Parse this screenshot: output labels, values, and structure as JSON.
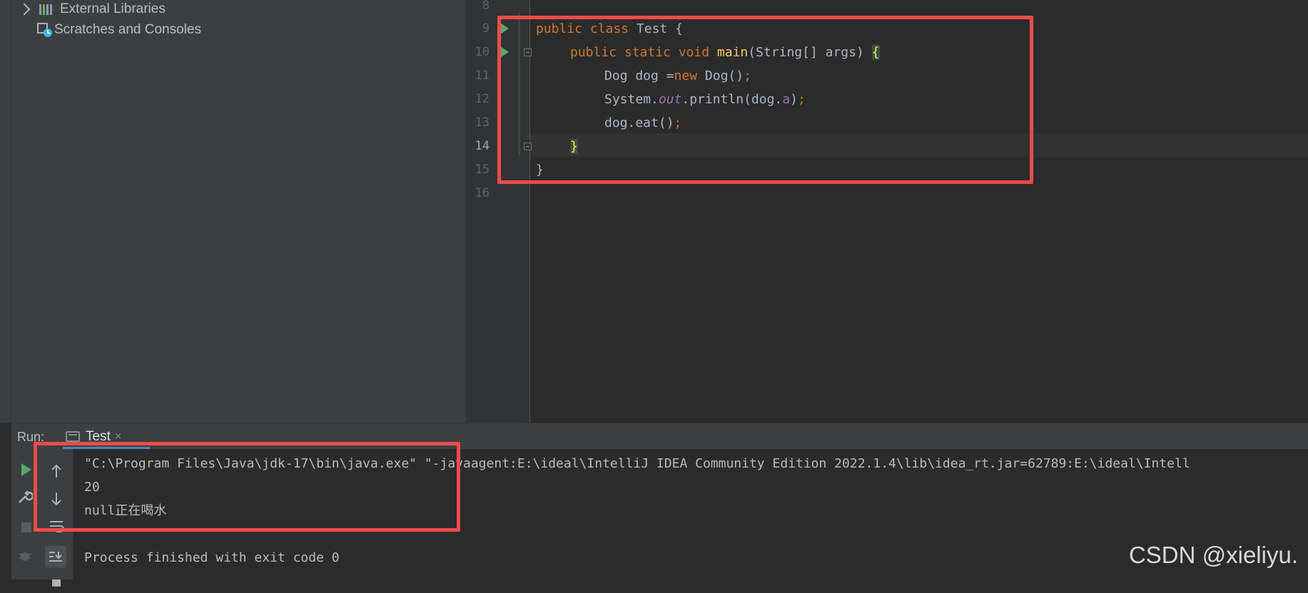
{
  "project_tree": {
    "items": [
      {
        "label": "External Libraries",
        "expandable": true,
        "icon": "library-icon"
      },
      {
        "label": "Scratches and Consoles",
        "expandable": false,
        "icon": "scratches-icon"
      }
    ]
  },
  "editor": {
    "line_numbers": [
      "8",
      "9",
      "10",
      "11",
      "12",
      "13",
      "14",
      "15",
      "16"
    ],
    "current_line": "14",
    "code": {
      "l9_kw": "public class ",
      "l9_rest": "Test {",
      "l10_kw": "public static void ",
      "l10_fn": "main",
      "l10_rest": "(String[] args) ",
      "l10_brace": "{",
      "l11_a": "Dog dog =",
      "l11_kw": "new ",
      "l11_b": "Dog()",
      "l11_semi": ";",
      "l12_a": "System.",
      "l12_static": "out",
      "l12_b": ".println(dog.",
      "l12_field": "a",
      "l12_c": ")",
      "l12_semi": ";",
      "l13_a": "dog.eat()",
      "l13_semi": ";",
      "l14_brace": "}",
      "l15": "}"
    }
  },
  "run_panel": {
    "label": "Run:",
    "tab_name": "Test",
    "tab_close": "×",
    "console_lines": [
      "\"C:\\Program Files\\Java\\jdk-17\\bin\\java.exe\" \"-javaagent:E:\\ideal\\IntelliJ IDEA Community Edition 2022.1.4\\lib\\idea_rt.jar=62789:E:\\ideal\\Intell",
      "20",
      "null正在喝水",
      "",
      "Process finished with exit code 0"
    ]
  },
  "watermark": "CSDN @xieliyu.",
  "colors": {
    "annotation_red": "#ee4b4b",
    "keyword": "#cc7832",
    "function": "#ffc66d",
    "field": "#9876aa",
    "run_green": "#59a869"
  }
}
